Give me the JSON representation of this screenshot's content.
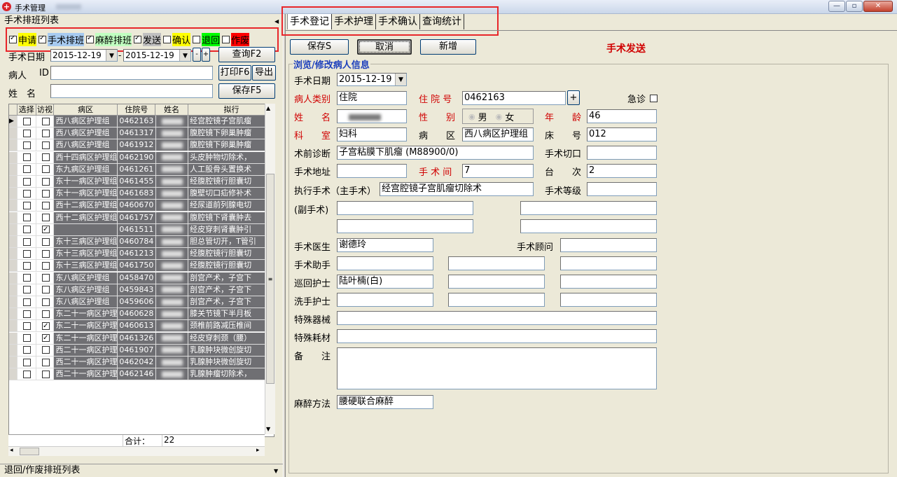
{
  "window": {
    "title": "手术管理",
    "minimize": "—",
    "maximize": "▫",
    "close": "✕"
  },
  "left": {
    "panel_title": "手术排班列表",
    "filters": [
      {
        "label": "申请",
        "checked": true,
        "bg": "#ffff00"
      },
      {
        "label": "手术排班",
        "checked": true,
        "bg": "#a6caf0"
      },
      {
        "label": "麻醉排班",
        "checked": true,
        "bg": "#c0ffc0"
      },
      {
        "label": "发送",
        "checked": true,
        "bg": "#c0c0c0"
      },
      {
        "label": "确认",
        "checked": false,
        "bg": "#ffff00"
      },
      {
        "label": "退回",
        "checked": false,
        "bg": "#00ff00"
      },
      {
        "label": "作废",
        "checked": false,
        "bg": "#ff0000"
      }
    ],
    "date_label": "手术日期",
    "date_from": "2015-12-19",
    "date_to": "2015-12-19",
    "query_button": "查询F2",
    "patient_label": "病人",
    "id_label": "ID",
    "name_label": "姓　名",
    "print_button": "打印F6",
    "export_button": "导出",
    "save_button": "保存F5",
    "columns": [
      "选择",
      "访视",
      "病区",
      "住院号",
      "姓名",
      "拟行"
    ],
    "rows": [
      {
        "visit": false,
        "ward": "西八病区护理组",
        "no": "0462163",
        "op": "经宫腔镜子宫肌瘤"
      },
      {
        "visit": false,
        "ward": "西八病区护理组",
        "no": "0461317",
        "op": "腹腔镜下卵巢肿瘤"
      },
      {
        "visit": false,
        "ward": "西八病区护理组",
        "no": "0461912",
        "op": "腹腔镜下卵巢肿瘤"
      },
      {
        "visit": false,
        "ward": "西十四病区护理组",
        "no": "0462190",
        "op": "头皮肿物切除术，"
      },
      {
        "visit": false,
        "ward": "东九病区护理组",
        "no": "0461261",
        "op": "人工股骨头置换术"
      },
      {
        "visit": false,
        "ward": "东十一病区护理组",
        "no": "0461455",
        "op": "经腹腔镜行胆囊切"
      },
      {
        "visit": false,
        "ward": "东十一病区护理组",
        "no": "0461683",
        "op": "腹壁切口疝修补术"
      },
      {
        "visit": false,
        "ward": "西十二病区护理组",
        "no": "0460670",
        "op": "经尿道前列腺电切"
      },
      {
        "visit": false,
        "ward": "西十二病区护理组",
        "no": "0461757",
        "op": "腹腔镜下肾囊肿去"
      },
      {
        "visit": true,
        "ward": "",
        "no": "0461511",
        "op": "经皮穿刺肾囊肿引"
      },
      {
        "visit": false,
        "ward": "东十三病区护理组",
        "no": "0460784",
        "op": "胆总管切开，T管引"
      },
      {
        "visit": false,
        "ward": "东十三病区护理组",
        "no": "0461213",
        "op": "经腹腔镜行胆囊切"
      },
      {
        "visit": false,
        "ward": "东十三病区护理组",
        "no": "0461750",
        "op": "经腹腔镜行胆囊切"
      },
      {
        "visit": false,
        "ward": "东八病区护理组",
        "no": "0458470",
        "op": "剖宫产术，子宫下"
      },
      {
        "visit": false,
        "ward": "东八病区护理组",
        "no": "0459843",
        "op": "剖宫产术，子宫下"
      },
      {
        "visit": false,
        "ward": "东八病区护理组",
        "no": "0459606",
        "op": "剖宫产术，子宫下"
      },
      {
        "visit": false,
        "ward": "东二十一病区护理组",
        "no": "0460628",
        "op": "膝关节镜下半月板"
      },
      {
        "visit": true,
        "ward": "东二十一病区护理组",
        "no": "0460613",
        "op": "颈椎前路减压椎间"
      },
      {
        "visit": true,
        "ward": "东二十一病区护理组",
        "no": "0461326",
        "op": "经皮穿刺颈（腰）"
      },
      {
        "visit": false,
        "ward": "西二十一病区护理组",
        "no": "0461907",
        "op": "乳腺肿块微创旋切"
      },
      {
        "visit": false,
        "ward": "西二十一病区护理组",
        "no": "0462042",
        "op": "乳腺肿块微创旋切"
      },
      {
        "visit": false,
        "ward": "西二十一病区护理组",
        "no": "0462146",
        "op": "乳腺肿瘤切除术，"
      }
    ],
    "total_label": "合计：",
    "total_value": "22",
    "bottom_title": "退回/作废排班列表"
  },
  "right": {
    "tabs": [
      "手术登记",
      "手术护理",
      "手术确认",
      "查询统计"
    ],
    "toolbar": {
      "save": "保存S",
      "cancel": "取消",
      "add": "新增",
      "status": "手术发送"
    },
    "group_title": "浏览/修改病人信息",
    "fields": {
      "op_date_label": "手术日期",
      "op_date": "2015-12-19",
      "patient_type_label": "病人类别",
      "patient_type": "住院",
      "inpatient_no_label": "住 院 号",
      "inpatient_no": "0462163",
      "plus": "+",
      "emergency_label": "急诊",
      "name_label": "姓　　名",
      "sex_label": "性　　别",
      "male": "男",
      "female": "女",
      "age_label": "年　　龄",
      "age": "46",
      "dept_label": "科　　室",
      "dept": "妇科",
      "ward_label": "病　　区",
      "ward": "西八病区护理组",
      "bed_label": "床　　号",
      "bed": "012",
      "diagnosis_label": "术前诊断",
      "diagnosis": "子宫粘膜下肌瘤 (M88900/0)",
      "incision_label": "手术切口",
      "address_label": "手术地址",
      "room_label": "手 术 间",
      "room": "7",
      "order_label": "台　　次",
      "order": "2",
      "main_op_label": "执行手术（主手术）",
      "main_op": "经宫腔镜子宫肌瘤切除术",
      "level_label": "手术等级",
      "sub_op_label": "(副手术)",
      "doctor_label": "手术医生",
      "doctor": "谢德玲",
      "consultant_label": "手术顾问",
      "assistant_label": "手术助手",
      "circ_nurse_label": "巡回护士",
      "circ_nurse": "陆叶楠(白)",
      "scrub_nurse_label": "洗手护士",
      "instrument_label": "特殊器械",
      "consumable_label": "特殊耗材",
      "remark_label": "备　　注",
      "anesthesia_label": "麻醉方法",
      "anesthesia": "腰硬联合麻醉"
    }
  }
}
